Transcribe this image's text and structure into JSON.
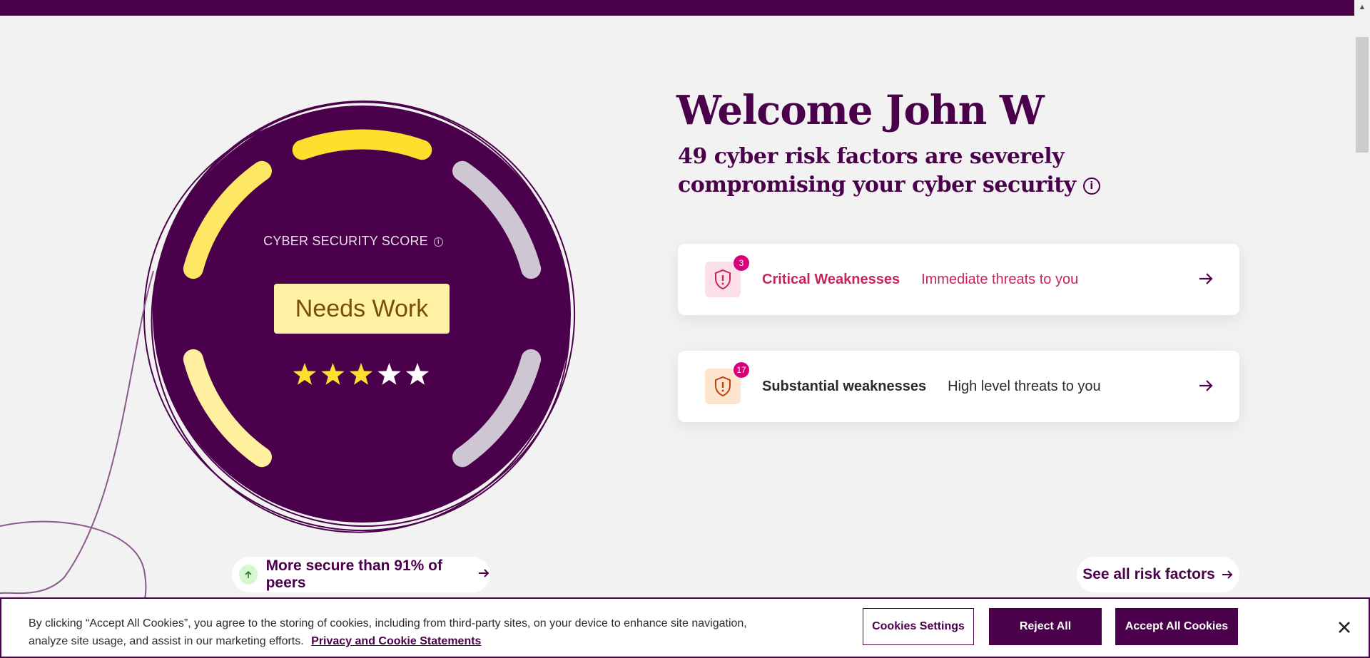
{
  "header": {
    "bar_color": "#4b004b"
  },
  "score": {
    "title": "CYBER SECURITY SCORE",
    "info_symbol": "i",
    "rating": "Needs Work",
    "stars_filled": 3,
    "stars_total": 5,
    "gauge_segments_active": 3,
    "gauge_segments_total": 6
  },
  "peers": {
    "label": "More secure than 91% of peers",
    "direction": "up"
  },
  "welcome": {
    "title": "Welcome John W",
    "summary": "49 cyber risk factors are severely compromising your cyber security",
    "info_symbol": "i"
  },
  "weaknesses": [
    {
      "count": "3",
      "name": "Critical Weaknesses",
      "description": "Immediate threats to you",
      "icon": "shield-alert-icon",
      "color": "#c8235e"
    },
    {
      "count": "17",
      "name": "Substantial weaknesses",
      "description": "High level threats to you",
      "icon": "shield-alert-icon",
      "color": "#c2410c"
    }
  ],
  "see_all": {
    "label": "See all risk factors"
  },
  "cookie": {
    "text": "By clicking “Accept All Cookies”, you agree to the storing of cookies, including from third-party sites, on your device to enhance site navigation, analyze site usage, and assist in our marketing efforts.",
    "link": "Privacy and Cookie Statements",
    "settings_label": "Cookies Settings",
    "reject_label": "Reject All",
    "accept_label": "Accept All Cookies",
    "close_symbol": "×"
  },
  "colors": {
    "brand": "#4b004b",
    "accent_yellow": "#ffdf2e",
    "critical": "#c8235e",
    "badge": "#d6007a"
  }
}
